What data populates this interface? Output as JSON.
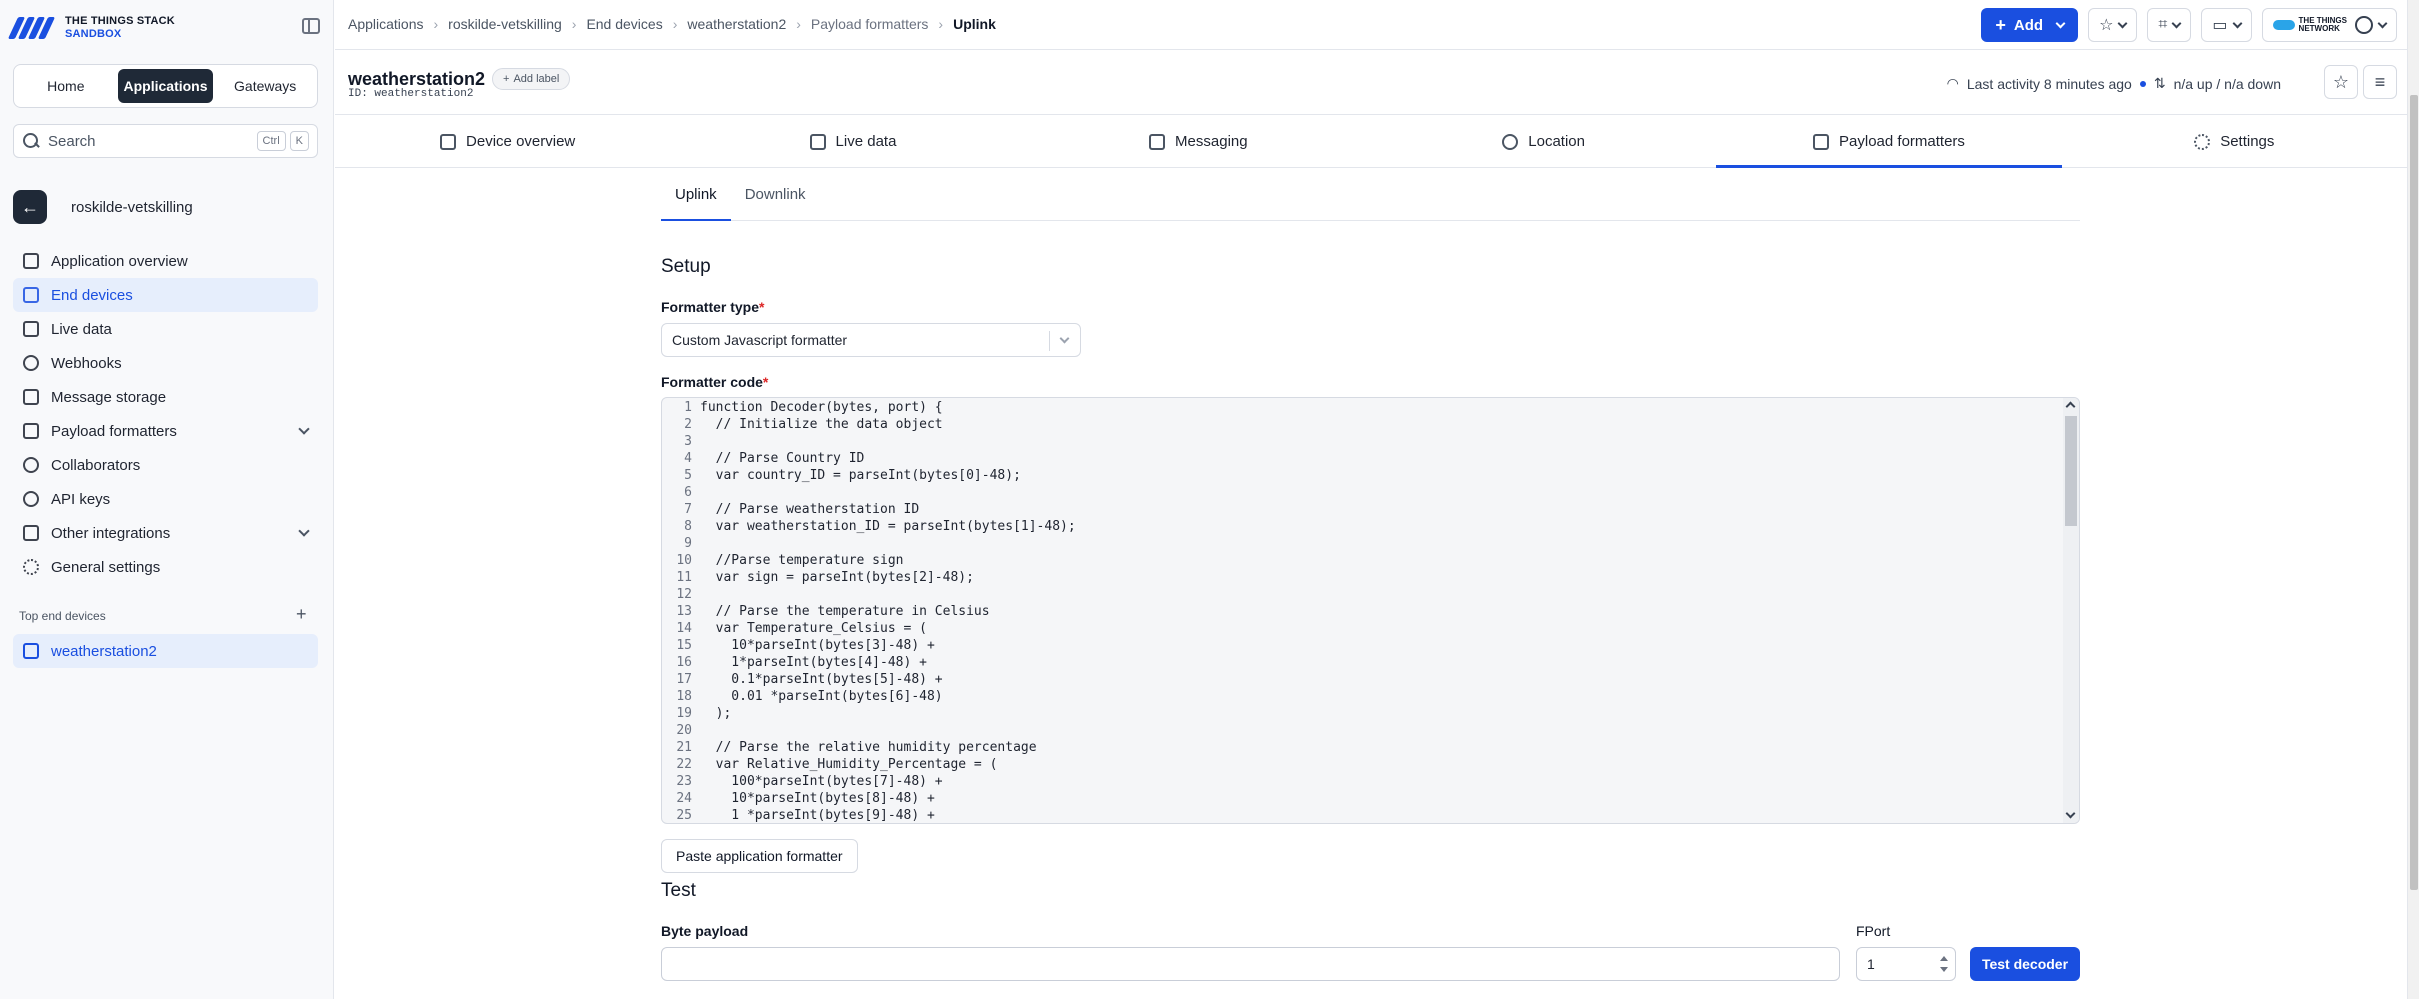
{
  "brand": {
    "line1": "THE THINGS STACK",
    "line2": "SANDBOX"
  },
  "switcher": {
    "home": "Home",
    "applications": "Applications",
    "gateways": "Gateways"
  },
  "search": {
    "placeholder": "Search",
    "key1": "Ctrl",
    "key2": "K"
  },
  "application_name": "roskilde-vetskilling",
  "sidebar": {
    "items": [
      {
        "label": "Application overview"
      },
      {
        "label": "End devices"
      },
      {
        "label": "Live data"
      },
      {
        "label": "Webhooks"
      },
      {
        "label": "Message storage"
      },
      {
        "label": "Payload formatters"
      },
      {
        "label": "Collaborators"
      },
      {
        "label": "API keys"
      },
      {
        "label": "Other integrations"
      },
      {
        "label": "General settings"
      }
    ],
    "top_devices_label": "Top end devices",
    "top_device": "weatherstation2"
  },
  "breadcrumb": [
    "Applications",
    "roskilde-vetskilling",
    "End devices",
    "weatherstation2",
    "Payload formatters",
    "Uplink"
  ],
  "header": {
    "add_label": "Add",
    "ttn_line1": "THE THINGS",
    "ttn_line2": "NETWORK"
  },
  "device": {
    "name": "weatherstation2",
    "id": "ID: weatherstation2",
    "add_label": "Add label",
    "last_activity": "Last activity 8 minutes ago",
    "traffic": "n/a up / n/a down"
  },
  "tabs": [
    "Device overview",
    "Live data",
    "Messaging",
    "Location",
    "Payload formatters",
    "Settings"
  ],
  "subtabs": [
    "Uplink",
    "Downlink"
  ],
  "setup": {
    "heading": "Setup",
    "formatter_type_label": "Formatter type",
    "formatter_type_value": "Custom Javascript formatter",
    "formatter_code_label": "Formatter code"
  },
  "code_lines": [
    "function Decoder(bytes, port) {",
    "  // Initialize the data object",
    "",
    "  // Parse Country ID",
    "  var country_ID = parseInt(bytes[0]-48);",
    "",
    "  // Parse weatherstation ID",
    "  var weatherstation_ID = parseInt(bytes[1]-48);",
    "",
    "  //Parse temperature sign",
    "  var sign = parseInt(bytes[2]-48);",
    "",
    "  // Parse the temperature in Celsius",
    "  var Temperature_Celsius = (",
    "    10*parseInt(bytes[3]-48) +",
    "    1*parseInt(bytes[4]-48) +",
    "    0.1*parseInt(bytes[5]-48) +",
    "    0.01 *parseInt(bytes[6]-48)",
    "  );",
    "",
    "  // Parse the relative humidity percentage",
    "  var Relative_Humidity_Percentage = (",
    "    100*parseInt(bytes[7]-48) +",
    "    10*parseInt(bytes[8]-48) +",
    "    1 *parseInt(bytes[9]-48) +"
  ],
  "paste_button": "Paste application formatter",
  "test": {
    "heading": "Test",
    "byte_payload_label": "Byte payload",
    "byte_payload_value": "",
    "fport_label": "FPort",
    "fport_value": "1",
    "test_button": "Test decoder"
  },
  "colors": {
    "accent": "#1a4fe0",
    "dark": "#1f2937",
    "required": "#dc2626"
  }
}
